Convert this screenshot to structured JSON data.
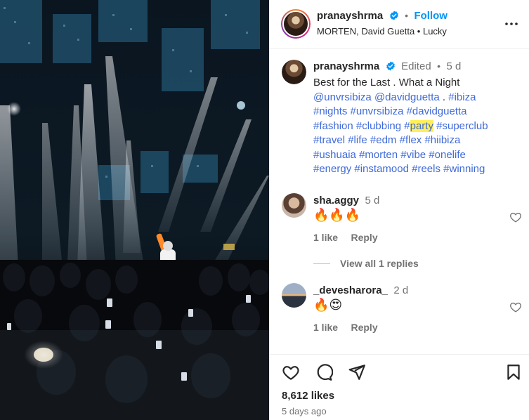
{
  "post": {
    "author": "pranayshrma",
    "follow_label": "Follow",
    "audio": "MORTEN, David Guetta • Lucky"
  },
  "caption": {
    "author": "pranayshrma",
    "edited": "Edited",
    "age": "5 d",
    "text_start": "Best for the Last . What a Night",
    "mentions": [
      "@unvrsibiza",
      "@davidguetta"
    ],
    "sep": ".",
    "tags_line1": [
      "#ibiza"
    ],
    "tags": [
      "#nights",
      "#unvrsibiza",
      "#davidguetta",
      "#fashion",
      "#clubbing"
    ],
    "hash_prefix": "#",
    "highlighted_tag": "party",
    "tags_after": [
      "#superclub",
      "#travel",
      "#life",
      "#edm",
      "#flex",
      "#hiibiza",
      "#ushuaia",
      "#morten",
      "#vibe",
      "#onelife",
      "#energy",
      "#instamood",
      "#reels",
      "#winning"
    ]
  },
  "comments": [
    {
      "author": "sha.aggy",
      "age": "5 d",
      "text": "🔥🔥🔥",
      "likes": "1 like",
      "reply": "Reply"
    },
    {
      "author": "_devesharora_",
      "age": "2 d",
      "text": "🔥😍",
      "likes": "1 like",
      "reply": "Reply"
    }
  ],
  "view_replies": "View all 1 replies",
  "footer": {
    "likes": "8,612 likes",
    "posted": "5 days ago"
  },
  "icons": [
    "more-icon",
    "heart-icon",
    "comment-icon",
    "share-icon",
    "bookmark-icon",
    "verified-icon"
  ]
}
